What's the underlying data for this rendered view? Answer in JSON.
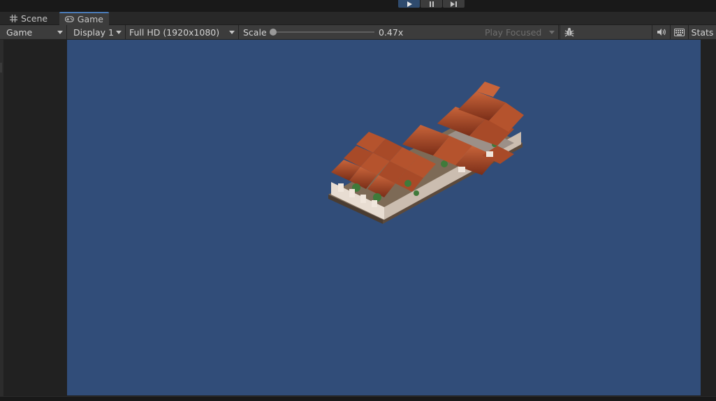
{
  "tabs": {
    "scene": {
      "label": "Scene",
      "icon": "grid-icon"
    },
    "game": {
      "label": "Game",
      "icon": "gamepad-icon",
      "active": true
    }
  },
  "play_controls": {
    "play": {
      "icon": "play-icon",
      "active": true
    },
    "pause": {
      "icon": "pause-icon"
    },
    "step": {
      "icon": "step-icon"
    }
  },
  "toolbar": {
    "view_mode": "Game",
    "display": "Display 1",
    "resolution": "Full HD (1920x1080)",
    "scale_label": "Scale",
    "scale_value": "0.47x",
    "scale_fraction": 0.0,
    "play_mode": "Play Focused",
    "debug_icon": "bug-icon",
    "mute_icon": "speaker-icon",
    "shortcuts_icon": "keyboard-icon",
    "stats_label": "Stats"
  },
  "colors": {
    "accent": "#4a7bb7",
    "game_background": "#314d79",
    "editor_background": "#191919",
    "panel": "#3c3c3c"
  }
}
